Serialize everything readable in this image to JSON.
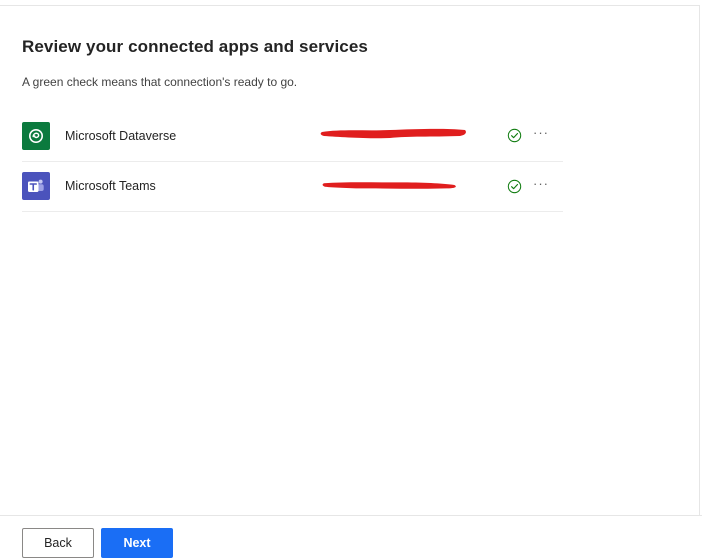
{
  "header": {
    "title": "Review your connected apps and services",
    "subtitle": "A green check means that connection's ready to go."
  },
  "connections": [
    {
      "name": "Microsoft Dataverse",
      "icon": "dataverse-icon",
      "icon_color": "#0b7a3e",
      "status": "connected",
      "status_icon": "check-circle-icon",
      "more_label": "···"
    },
    {
      "name": "Microsoft Teams",
      "icon": "teams-icon",
      "icon_color": "#4b53bc",
      "status": "connected",
      "status_icon": "check-circle-icon",
      "more_label": "···"
    }
  ],
  "footer": {
    "back_label": "Back",
    "next_label": "Next"
  },
  "colors": {
    "accent": "#1a6ef5",
    "success": "#107c10",
    "redaction": "#e01e1e"
  }
}
